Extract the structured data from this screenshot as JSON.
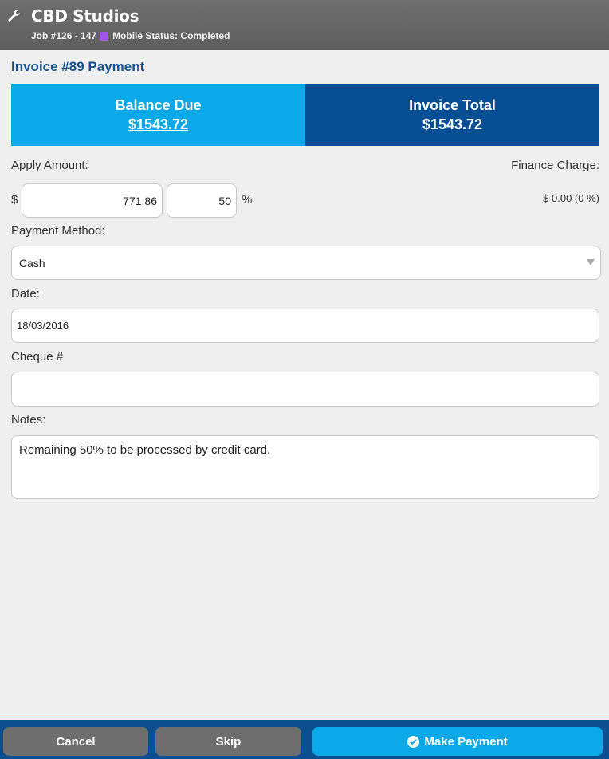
{
  "header": {
    "app_title": "CBD Studios",
    "job_label": "Job #126 - 147",
    "status_label": "Mobile Status: Completed",
    "status_color": "#a155e8"
  },
  "page": {
    "title": "Invoice #89 Payment"
  },
  "totals": {
    "balance_label": "Balance Due",
    "balance_amount": "$1543.72",
    "invoice_label": "Invoice Total",
    "invoice_amount": "$1543.72"
  },
  "form": {
    "apply_amount_label": "Apply Amount:",
    "currency_symbol": "$",
    "apply_amount_value": "771.86",
    "apply_percent_value": "50",
    "percent_symbol": "%",
    "finance_charge_label": "Finance Charge:",
    "finance_charge_value": "$ 0.00 (0 %)",
    "payment_method_label": "Payment Method:",
    "payment_method_value": "Cash",
    "date_label": "Date:",
    "date_value": "18/03/2016",
    "cheque_label": "Cheque #",
    "cheque_value": "",
    "notes_label": "Notes:",
    "notes_value": "Remaining 50% to be processed by credit card."
  },
  "footer": {
    "cancel_label": "Cancel",
    "skip_label": "Skip",
    "make_payment_label": "Make Payment"
  },
  "colors": {
    "header_bg": "#666666",
    "accent_blue": "#0ba9e8",
    "dark_blue": "#064f94"
  }
}
